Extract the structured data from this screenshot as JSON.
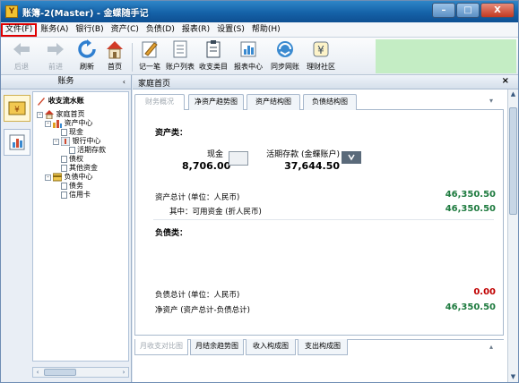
{
  "window": {
    "app_icon_text": "Y",
    "title": "账簿-2(Master) - 金蝶随手记",
    "btn_min": "–",
    "btn_max": "□",
    "btn_close": "X"
  },
  "menu": [
    "文件(F)",
    "账务(A)",
    "银行(B)",
    "资产(C)",
    "负债(D)",
    "报表(R)",
    "设置(S)",
    "帮助(H)"
  ],
  "toolbar": {
    "back": "后退",
    "forward": "前进",
    "refresh": "刷新",
    "home": "首页",
    "note": "记一笔",
    "accounts_list": "账户列表",
    "income_expense_types": "收支类目",
    "report_center": "报表中心",
    "sync": "同步网账",
    "finance_community": "理财社区"
  },
  "sidebar": {
    "header": "账务",
    "collapse": "‹",
    "tree": {
      "root": "收支流水账",
      "home": "家庭首页",
      "assets": "资产中心",
      "cash": "现金",
      "bank": "银行中心",
      "deposit": "活期存款",
      "claims": "债权",
      "other_funds": "其他资金",
      "liabilities": "负债中心",
      "debt": "债务",
      "credit_card": "信用卡"
    },
    "scroll_left": "‹",
    "scroll_right": "›"
  },
  "main": {
    "header": "家庭首页",
    "close": "×",
    "tabs": [
      "财务概况",
      "净资产趋势图",
      "资产结构图",
      "负债结构图"
    ],
    "tab_menu": "▾",
    "assets_section": "资产类：",
    "cash_label": "现金",
    "cash_value": "8,706.00",
    "deposit_label": "活期存款 (金蝶账户)",
    "deposit_value": "37,644.50",
    "total_assets_label": "资产总计 (单位：人民币)",
    "total_assets_value": "46,350.50",
    "available_label": "其中：可用资金 (折人民币)",
    "available_value": "46,350.50",
    "liabilities_section": "负债类：",
    "total_liab_label": "负债总计 (单位：人民币)",
    "total_liab_value": "0.00",
    "net_assets_label": "净资产 (资产总计-负债总计)",
    "net_assets_value": "46,350.50",
    "bottom_tabs": [
      "月收支对比图",
      "月结余趋势图",
      "收入构成图",
      "支出构成图"
    ],
    "bottom_tab_menu": "▴"
  },
  "colors": {
    "titlebar": "#1562a8",
    "highlight_box": "#e00000",
    "positive_value": "#1d7a3e",
    "zero_value": "#c00000",
    "green_banner": "#c4edc4"
  }
}
